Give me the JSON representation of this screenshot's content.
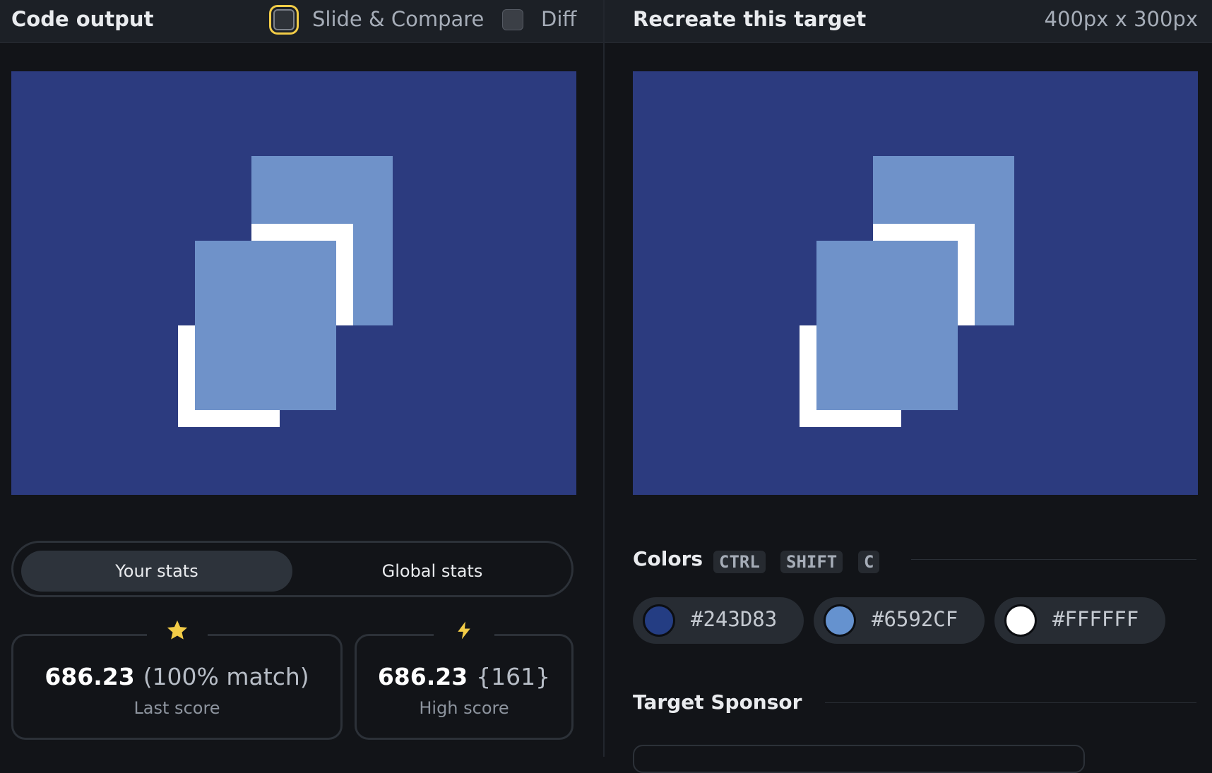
{
  "header_left": {
    "title": "Code output",
    "slide_compare_label": "Slide & Compare",
    "diff_label": "Diff"
  },
  "header_right": {
    "title": "Recreate this target",
    "size_label": "400px x 300px"
  },
  "stats": {
    "tab_yours": "Your stats",
    "tab_global": "Global stats",
    "last_score_value": "686.23",
    "last_score_match": "(100% match)",
    "last_score_label": "Last score",
    "high_score_value": "686.23",
    "high_score_extra": "{161}",
    "high_score_label": "High score"
  },
  "colors": {
    "title": "Colors",
    "shortcut_keys": [
      "CTRL",
      "SHIFT",
      "C"
    ],
    "swatches": [
      {
        "hex": "#243D83"
      },
      {
        "hex": "#6592CF"
      },
      {
        "hex": "#FFFFFF"
      }
    ]
  },
  "sponsor": {
    "title": "Target Sponsor"
  },
  "icons": {
    "last_score": "star-icon",
    "high_score": "lightning-icon"
  },
  "palette": {
    "canvas_bg": "#2C3B7F",
    "square_fill": "#6F92C9",
    "outline": "#FFFFFF",
    "accent": "#F2CC47"
  }
}
